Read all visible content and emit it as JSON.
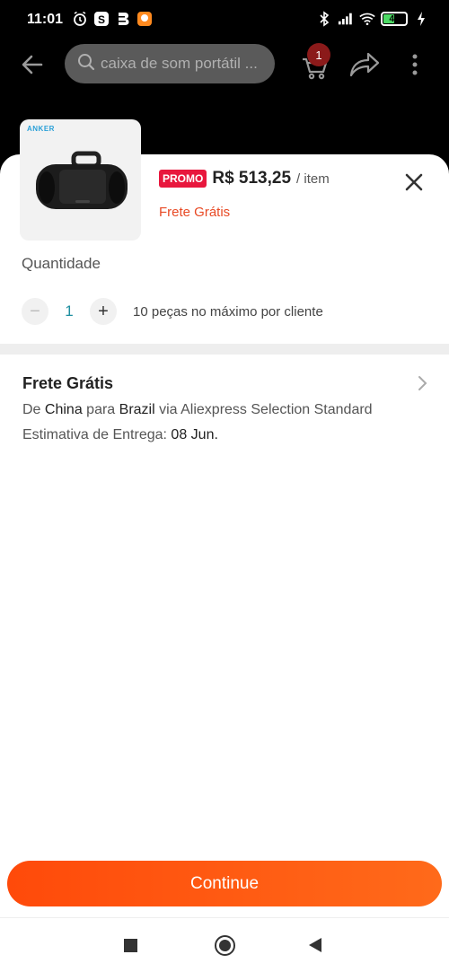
{
  "status_bar": {
    "time": "11:01",
    "battery": "48",
    "battery_level": 0.48,
    "icons_left": [
      "alarm-icon",
      "s-app-icon",
      "b-app-icon",
      "orange-app-icon"
    ],
    "icons_right": [
      "bluetooth-icon",
      "signal-icon",
      "wifi-icon",
      "battery-icon",
      "charging-icon"
    ]
  },
  "app_bar": {
    "search_placeholder": "caixa de som portátil ...",
    "cart_count": "1"
  },
  "product": {
    "brand": "ANKER",
    "promo_label": "PROMO",
    "price": "R$ 513,25",
    "per_item": "/ item",
    "free_shipping": "Frete Grátis"
  },
  "quantity": {
    "label": "Quantidade",
    "minus": "−",
    "value": "1",
    "plus": "+",
    "note": "10 peças no máximo por cliente"
  },
  "shipping": {
    "title": "Frete Grátis",
    "route_from_prefix": "De ",
    "from": "China",
    "to_prefix": " para ",
    "to": "Brazil",
    "via": " via Aliexpress Selection Standard",
    "eta_label": "Estimativa de Entrega: ",
    "eta_date": "08 Jun."
  },
  "continue_label": "Continue",
  "colors": {
    "accent": "#ff4a0a",
    "promo": "#e8173d",
    "free_shipping": "#e84a25",
    "quantity_value": "#1f8fa0",
    "cart_badge": "#8b1a1a"
  }
}
